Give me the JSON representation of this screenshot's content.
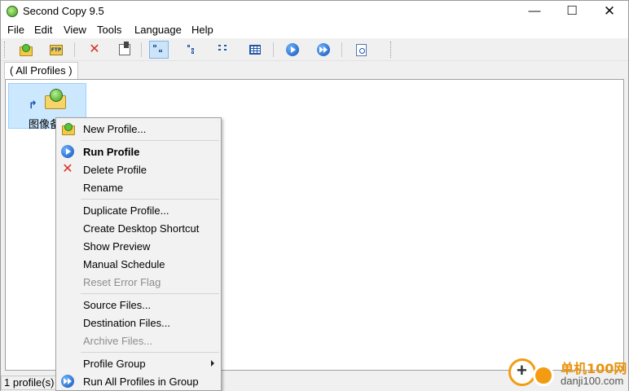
{
  "window": {
    "title": "Second Copy 9.5",
    "controls": {
      "minimize": "—",
      "maximize": "☐",
      "close": "✕"
    }
  },
  "menubar": [
    "File",
    "Edit",
    "View",
    "Tools",
    "Language",
    "Help"
  ],
  "toolbar": {
    "buttons": [
      {
        "icon": "new-profile-icon"
      },
      {
        "icon": "ftp-icon",
        "text": "FTP"
      },
      {
        "icon": "delete-icon"
      },
      {
        "icon": "properties-icon"
      },
      {
        "icon": "large-icons-view-icon",
        "active": true
      },
      {
        "icon": "tree-view-icon"
      },
      {
        "icon": "list-view-icon"
      },
      {
        "icon": "details-view-icon"
      },
      {
        "icon": "run-profile-icon"
      },
      {
        "icon": "run-all-icon"
      },
      {
        "icon": "preview-icon"
      }
    ]
  },
  "group_tab": {
    "label": "(  All Profiles  )"
  },
  "profiles": [
    {
      "name": "图像备",
      "selected": true
    }
  ],
  "context_menu": {
    "items": [
      {
        "label": "New Profile...",
        "icon": "new-profile-icon"
      },
      {
        "label": "Run Profile",
        "icon": "run-profile-icon",
        "bold": true
      },
      {
        "label": "Delete Profile",
        "icon": "delete-icon"
      },
      {
        "label": "Rename"
      },
      {
        "label": "Duplicate Profile..."
      },
      {
        "label": "Create Desktop Shortcut"
      },
      {
        "label": "Show Preview"
      },
      {
        "label": "Manual Schedule"
      },
      {
        "label": "Reset Error Flag",
        "disabled": true
      },
      {
        "label": "Source Files..."
      },
      {
        "label": "Destination Files..."
      },
      {
        "label": "Archive Files...",
        "disabled": true
      },
      {
        "label": "Profile Group",
        "submenu": true
      },
      {
        "label": "Run All Profiles in Group",
        "icon": "run-all-icon"
      }
    ]
  },
  "statusbar": {
    "profile_count": "1 profile(s)"
  },
  "watermark": {
    "site_name": "单机100网",
    "site_url": "danji100.com"
  },
  "colors": {
    "selection": "#cce8ff",
    "accent_blue": "#1452b5",
    "delete_red": "#d93025",
    "watermark_orange": "#f39c12"
  }
}
